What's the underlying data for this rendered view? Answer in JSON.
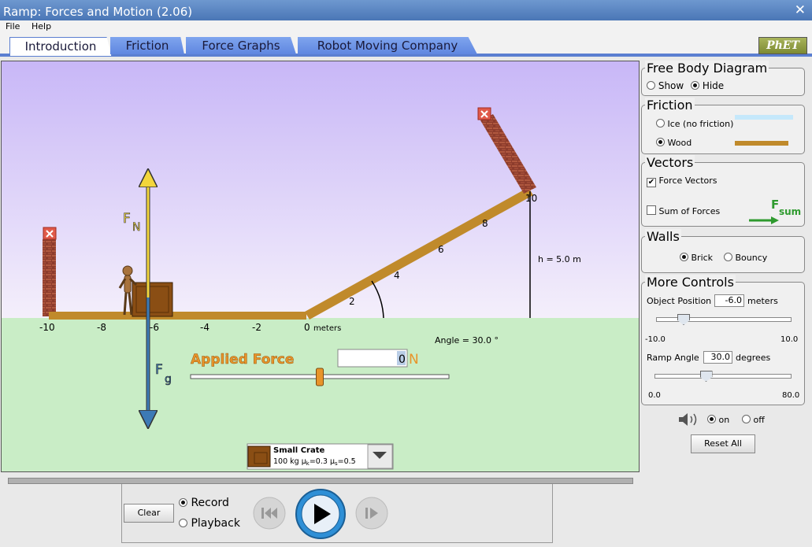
{
  "window": {
    "title": "Ramp: Forces and Motion (2.06)",
    "close": "✕"
  },
  "menu": [
    "File",
    "Help"
  ],
  "tabs": [
    "Introduction",
    "Friction",
    "Force Graphs",
    "Robot Moving Company"
  ],
  "logo": "PhET",
  "colors": {
    "sky_top": "#c8b7f7",
    "sky_bottom": "#f4effb",
    "ground": "#c9edc6",
    "ramp": "#c08a2b",
    "normal_force": "#f3d63c",
    "gravity_force": "#3c7ab6",
    "applied_force": "#e8942a",
    "tab_blue": "#6c93e6"
  },
  "scene": {
    "axis_ticks": [
      "-10",
      "-8",
      "-6",
      "-4",
      "-2",
      "0"
    ],
    "axis_unit": "meters",
    "ramp_ticks": [
      "2",
      "4",
      "6",
      "8",
      "10"
    ],
    "height_label": "h = 5.0 m",
    "angle_label": "Angle = 30.0 °",
    "normal_force_label": "F",
    "normal_force_sub": "N",
    "gravity_force_label": "F",
    "gravity_force_sub": "g",
    "applied_force_label": "Applied Force",
    "applied_force_value": "0",
    "applied_force_unit": "N",
    "applied_force_fraction": 0.5,
    "object_selector": {
      "name": "Small Crate",
      "mass": "100 kg",
      "mu_k": "0.3",
      "mu_s": "0.5"
    }
  },
  "controls": {
    "fbd": {
      "title": "Free Body Diagram",
      "show": "Show",
      "hide": "Hide",
      "selected": "hide"
    },
    "friction": {
      "title": "Friction",
      "ice": "Ice (no friction)",
      "wood": "Wood",
      "selected": "wood"
    },
    "vectors": {
      "title": "Vectors",
      "force_vectors": "Force Vectors",
      "force_vectors_checked": true,
      "sum_of_forces": "Sum of Forces",
      "sum_checked": false,
      "sum_icon_label": "F",
      "sum_icon_sub": "sum"
    },
    "walls": {
      "title": "Walls",
      "brick": "Brick",
      "bouncy": "Bouncy",
      "selected": "brick"
    },
    "more": {
      "title": "More Controls",
      "object_position_label": "Object Position",
      "object_position_value": "-6.0",
      "object_position_unit": "meters",
      "position_min": "-10.0",
      "position_max": "10.0",
      "position_fraction": 0.2,
      "ramp_angle_label": "Ramp Angle",
      "ramp_angle_value": "30.0",
      "ramp_angle_unit": "degrees",
      "angle_min": "0.0",
      "angle_max": "80.0",
      "angle_fraction": 0.375
    },
    "sound": {
      "on": "on",
      "off": "off",
      "selected": "on"
    },
    "reset_all": "Reset All"
  },
  "playback": {
    "clear": "Clear",
    "record": "Record",
    "playback": "Playback",
    "selected": "record"
  }
}
